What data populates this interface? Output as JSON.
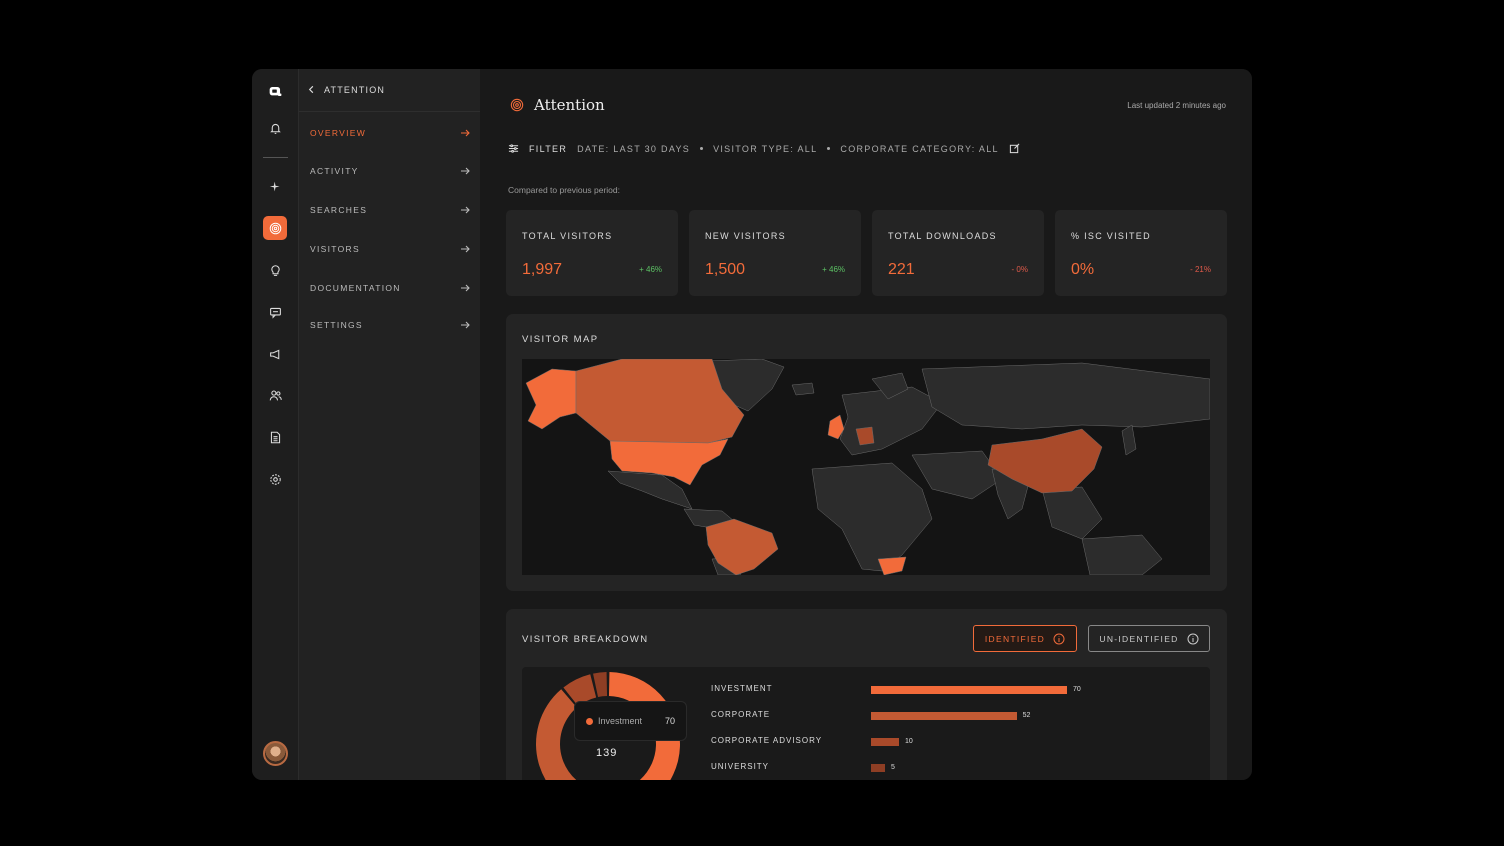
{
  "sidebar": {
    "back_label": "ATTENTION",
    "items": [
      {
        "label": "OVERVIEW",
        "active": true
      },
      {
        "label": "ACTIVITY"
      },
      {
        "label": "SEARCHES"
      },
      {
        "label": "VISITORS"
      },
      {
        "label": "DOCUMENTATION"
      },
      {
        "label": "SETTINGS"
      }
    ]
  },
  "rail": {
    "icons": [
      "logo-icon",
      "bell-icon",
      "sparkle-icon",
      "target-icon",
      "lightbulb-icon",
      "chat-icon",
      "megaphone-icon",
      "users-icon",
      "document-icon",
      "gear-icon"
    ],
    "active": "target-icon"
  },
  "header": {
    "title": "Attention",
    "last_updated": "Last updated 2 minutes ago"
  },
  "filter": {
    "label": "FILTER",
    "date": "DATE: LAST 30 DAYS",
    "visitor_type": "VISITOR TYPE: ALL",
    "corporate_category": "CORPORATE CATEGORY: ALL"
  },
  "compared_note": "Compared to previous period:",
  "stats": [
    {
      "label": "TOTAL VISITORS",
      "value": "1,997",
      "change": "+ 46%",
      "trend": "up"
    },
    {
      "label": "NEW VISITORS",
      "value": "1,500",
      "change": "+ 46%",
      "trend": "up"
    },
    {
      "label": "TOTAL DOWNLOADS",
      "value": "221",
      "change": "- 0%",
      "trend": "down"
    },
    {
      "label": "% ISC VISITED",
      "value": "0%",
      "change": "- 21%",
      "trend": "down"
    }
  ],
  "visitor_map": {
    "title": "VISITOR MAP",
    "highlighted_countries": [
      "Canada",
      "United States",
      "Alaska",
      "Brazil",
      "United Kingdom",
      "Germany",
      "China",
      "South Africa"
    ]
  },
  "breakdown": {
    "title": "VISITOR BREAKDOWN",
    "toggle_identified": "IDENTIFIED",
    "toggle_unidentified": "UN-IDENTIFIED",
    "tooltip_label": "Investment",
    "tooltip_value": "70",
    "total": "139",
    "rows": [
      {
        "label": "INVESTMENT",
        "value": 70,
        "display": "70",
        "color": "#f26b3a"
      },
      {
        "label": "CORPORATE",
        "value": 52,
        "display": "52",
        "color": "#c45a33"
      },
      {
        "label": "CORPORATE ADVISORY",
        "value": 10,
        "display": "10",
        "color": "#a94a2a"
      },
      {
        "label": "UNIVERSITY",
        "value": 5,
        "display": "5",
        "color": "#8e3e24"
      }
    ]
  },
  "colors": {
    "accent": "#f26b3a",
    "positive": "#5cc264",
    "negative": "#e05a4a"
  }
}
